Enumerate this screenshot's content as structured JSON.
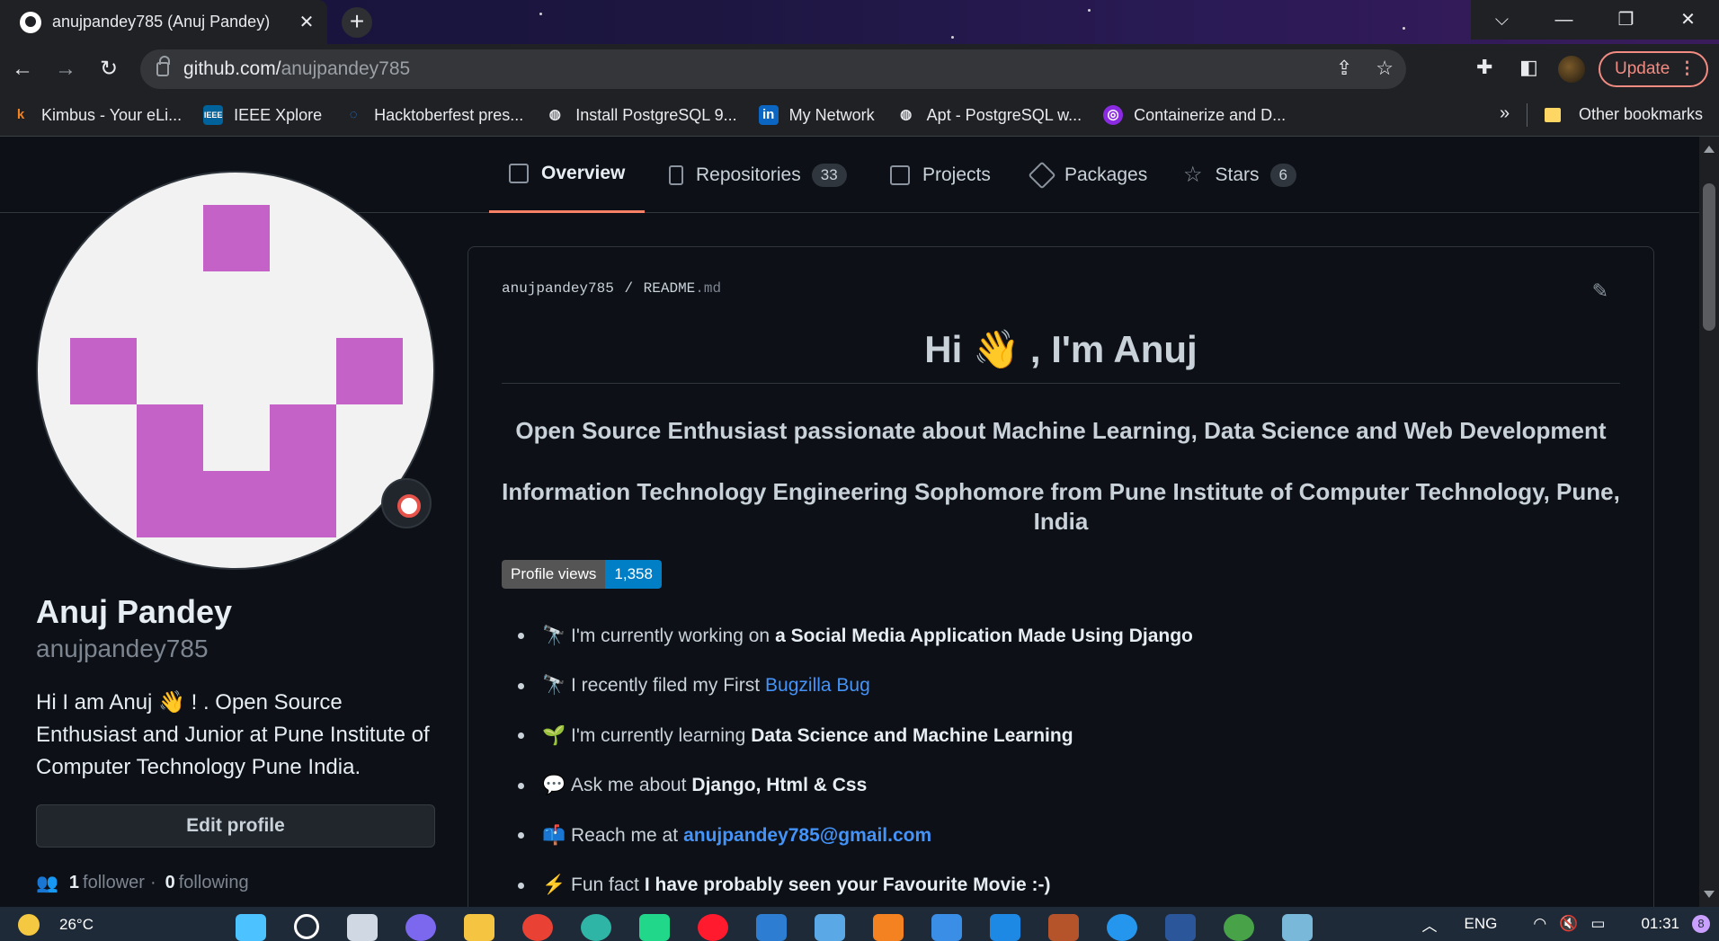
{
  "browser": {
    "tab_title": "anujpandey785 (Anuj Pandey)",
    "tab_close": "✕",
    "new_tab": "+",
    "url_host": "github.com/",
    "url_path": "anujpandey785",
    "update_label": "Update",
    "update_menu": "⋮",
    "window_controls": [
      "⌵",
      "—",
      "❐",
      "✕"
    ]
  },
  "bookmarks": {
    "items": [
      {
        "label": "Kimbus - Your eLi...",
        "icon": "k",
        "color": "#f58220"
      },
      {
        "label": "IEEE Xplore",
        "icon": "IEEE",
        "color": "#00629b"
      },
      {
        "label": "Hacktoberfest pres...",
        "icon": "◌",
        "color": "#2a7de1"
      },
      {
        "label": "Install PostgreSQL 9...",
        "icon": "◍",
        "color": "#e8eaed"
      },
      {
        "label": "My Network",
        "icon": "in",
        "color": "#0a66c2"
      },
      {
        "label": "Apt - PostgreSQL w...",
        "icon": "◍",
        "color": "#e8eaed"
      },
      {
        "label": "Containerize and D...",
        "icon": "◎",
        "color": "#8a2be2"
      }
    ],
    "more": "»",
    "other_label": "Other bookmarks"
  },
  "profile_tabs": {
    "overview": "Overview",
    "repositories": "Repositories",
    "repositories_count": "33",
    "projects": "Projects",
    "packages": "Packages",
    "stars": "Stars",
    "stars_count": "6"
  },
  "sidebar": {
    "name": "Anuj Pandey",
    "login": "anujpandey785",
    "bio": "Hi I am Anuj 👋 ! . Open Source Enthusiast and Junior at Pune Institute of Computer Technology Pune India.",
    "edit_profile": "Edit profile",
    "followers_count": "1",
    "followers_label": "follower",
    "separator": "·",
    "following_count": "0",
    "following_label": "following"
  },
  "readme": {
    "path_user": "anujpandey785",
    "path_sep": "/",
    "path_file": "README",
    "path_ext": ".md",
    "heading": "Hi 👋 , I'm Anuj",
    "subheading1": "Open Source Enthusiast passionate about Machine Learning, Data Science and Web Development",
    "subheading2": "Information Technology Engineering Sophomore from Pune Institute of Computer Technology, Pune, India",
    "badge_label": "Profile views",
    "badge_value": "1,358",
    "list": [
      {
        "emoji": "🔭",
        "text": "I'm currently working on",
        "strong": "a Social Media Application Made Using Django"
      },
      {
        "emoji": "🔭",
        "text": "I recently filed my First",
        "link": "Bugzilla Bug"
      },
      {
        "emoji": "🌱",
        "text": "I'm currently learning",
        "strong": "Data Science and Machine Learning"
      },
      {
        "emoji": "💬",
        "text": "Ask me about",
        "strong": "Django, Html & Css"
      },
      {
        "emoji": "📫",
        "text": "Reach me at",
        "link_bold": "anujpandey785@gmail.com"
      },
      {
        "emoji": "⚡",
        "text": "Fun fact",
        "strong": "I have probably seen your Favourite Movie :-)"
      }
    ]
  },
  "taskbar": {
    "temperature": "26°C",
    "language": "ENG",
    "time": "01:31",
    "notification_count": "8"
  }
}
